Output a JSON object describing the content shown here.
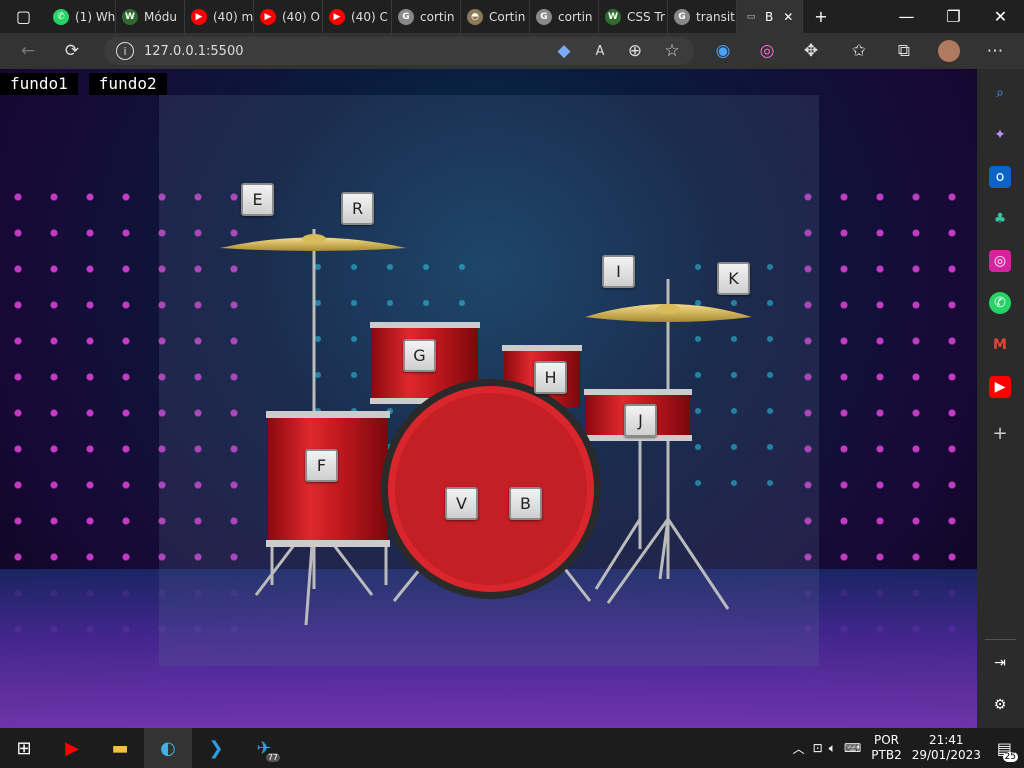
{
  "browser": {
    "tabs": [
      {
        "label": "(1) Wh",
        "icon": "whatsapp-icon",
        "color": "#25d366"
      },
      {
        "label": "Módu",
        "icon": "w-icon",
        "color": "#2f6b2f"
      },
      {
        "label": "(40) m",
        "icon": "youtube-icon",
        "color": "#ff0000"
      },
      {
        "label": "(40) O",
        "icon": "youtube-icon",
        "color": "#ff0000"
      },
      {
        "label": "(40) C",
        "icon": "youtube-icon",
        "color": "#ff0000"
      },
      {
        "label": "cortin",
        "icon": "google-icon",
        "color": "#888888"
      },
      {
        "label": "Cortin",
        "icon": "hat-icon",
        "color": "#8a7a55"
      },
      {
        "label": "cortin",
        "icon": "google-icon",
        "color": "#888888"
      },
      {
        "label": "CSS Tr",
        "icon": "w-icon",
        "color": "#2f6b2f"
      },
      {
        "label": "transit",
        "icon": "google-icon",
        "color": "#888888"
      },
      {
        "label": "B",
        "icon": "page-icon",
        "color": "#cccccc",
        "active": true
      }
    ],
    "url": "127.0.0.1:5500"
  },
  "page": {
    "links": [
      "fundo1",
      "fundo2"
    ],
    "keys": [
      "E",
      "R",
      "I",
      "K",
      "G",
      "H",
      "J",
      "F",
      "V",
      "B"
    ]
  },
  "taskbar": {
    "telegram_badge": "77",
    "lang": "POR",
    "layout": "PTB2",
    "time": "21:41",
    "date": "29/01/2023",
    "notif": "25"
  }
}
